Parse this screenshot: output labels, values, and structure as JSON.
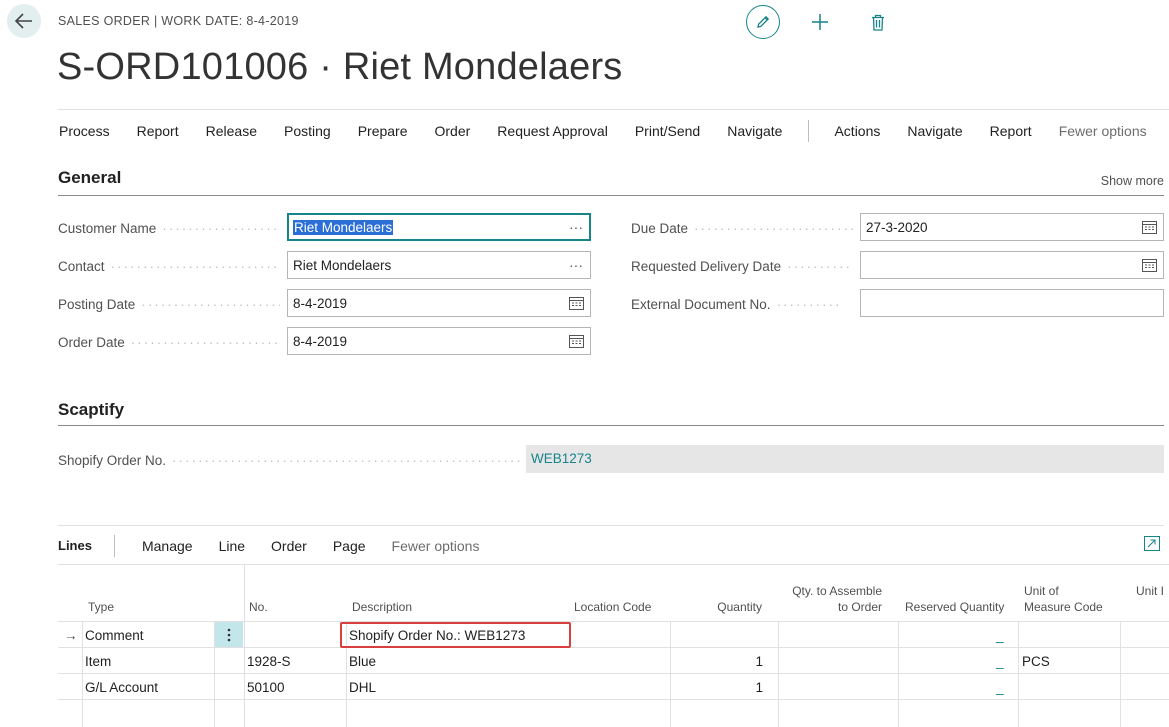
{
  "header": {
    "context": "SALES ORDER | WORK DATE: 8-4-2019",
    "title": "S-ORD101006 · Riet Mondelaers",
    "icons": [
      "back-arrow-icon",
      "pencil-icon",
      "plus-icon",
      "trash-icon"
    ]
  },
  "action_bar": {
    "items": [
      "Process",
      "Report",
      "Release",
      "Posting",
      "Prepare",
      "Order",
      "Request Approval",
      "Print/Send",
      "Navigate"
    ],
    "items2": [
      "Actions",
      "Navigate",
      "Report"
    ],
    "fewer": "Fewer options"
  },
  "general": {
    "title": "General",
    "show_more": "Show more",
    "customer_name": {
      "label": "Customer Name",
      "value": "Riet Mondelaers"
    },
    "contact": {
      "label": "Contact",
      "value": "Riet Mondelaers"
    },
    "posting_date": {
      "label": "Posting Date",
      "value": "8-4-2019"
    },
    "order_date": {
      "label": "Order Date",
      "value": "8-4-2019"
    },
    "due_date": {
      "label": "Due Date",
      "value": "27-3-2020"
    },
    "requested_delivery_date": {
      "label": "Requested Delivery Date",
      "value": ""
    },
    "external_document_no": {
      "label": "External Document No.",
      "value": ""
    }
  },
  "scaptify": {
    "title": "Scaptify",
    "shopify_order_no": {
      "label": "Shopify Order No.",
      "value": "WEB1273"
    }
  },
  "lines": {
    "title": "Lines",
    "actions": [
      "Manage",
      "Line",
      "Order",
      "Page"
    ],
    "fewer": "Fewer options",
    "columns": {
      "type": "Type",
      "no": "No.",
      "description": "Description",
      "location_code": "Location Code",
      "quantity": "Quantity",
      "qty_assemble_1": "Qty. to Assemble",
      "qty_assemble_2": "to Order",
      "reserved_quantity": "Reserved Quantity",
      "uom_1": "Unit of",
      "uom_2": "Measure Code",
      "unit_price": "Unit I"
    },
    "rows": [
      {
        "type": "Comment",
        "no": "",
        "description": "Shopify Order No.: WEB1273",
        "location": "",
        "quantity": "",
        "qty_assemble": "",
        "reserved": "_",
        "uom": ""
      },
      {
        "type": "Item",
        "no": "1928-S",
        "description": "Blue",
        "location": "",
        "quantity": "1",
        "qty_assemble": "",
        "reserved": "_",
        "uom": "PCS"
      },
      {
        "type": "G/L Account",
        "no": "50100",
        "description": "DHL",
        "location": "",
        "quantity": "1",
        "qty_assemble": "",
        "reserved": "_",
        "uom": ""
      }
    ]
  }
}
